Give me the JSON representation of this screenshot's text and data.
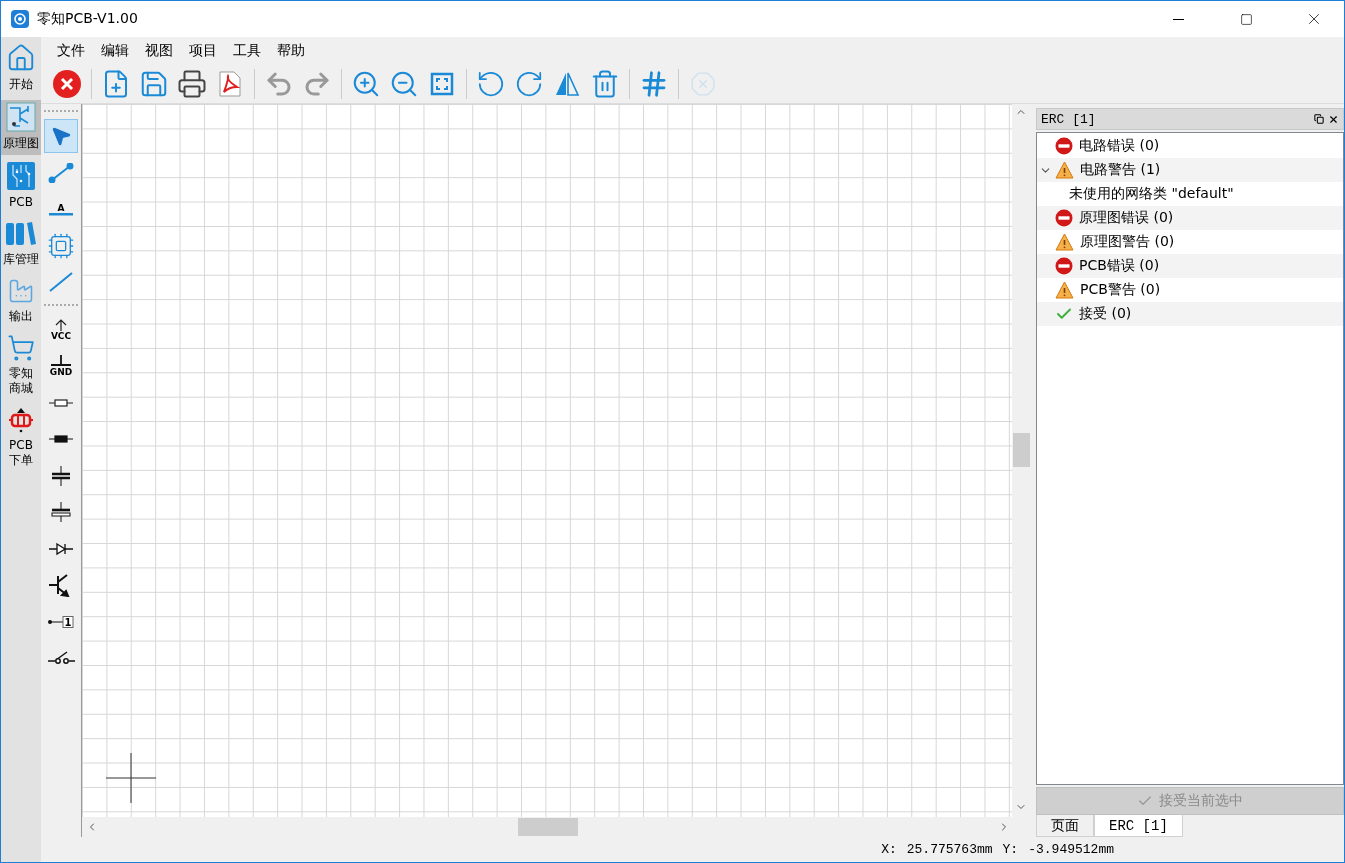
{
  "window": {
    "title": "零知PCB-V1.00"
  },
  "nav": [
    {
      "label": "开始",
      "selected": false
    },
    {
      "label": "原理图",
      "selected": true
    },
    {
      "label": "PCB",
      "selected": false
    },
    {
      "label": "库管理",
      "selected": false
    },
    {
      "label": "输出",
      "selected": false
    },
    {
      "label": "零知商城",
      "selected": false
    },
    {
      "label": "PCB下单",
      "selected": false
    }
  ],
  "menu": [
    "文件",
    "编辑",
    "视图",
    "项目",
    "工具",
    "帮助"
  ],
  "toolbar": [
    {
      "disabled": false
    },
    {
      "disabled": false
    },
    {
      "disabled": false
    },
    {
      "disabled": false
    },
    {
      "disabled": false
    },
    {
      "disabled": false
    },
    {
      "disabled": false
    },
    {
      "disabled": false
    },
    {
      "disabled": false
    },
    {
      "disabled": false
    },
    {
      "disabled": false
    },
    {
      "disabled": false
    },
    {
      "disabled": false
    },
    {
      "disabled": false
    },
    {
      "disabled": false
    },
    {
      "disabled": true
    }
  ],
  "tool_groups": [
    [
      {
        "selected": true
      },
      {
        "selected": false
      },
      {
        "selected": false,
        "label": "A"
      },
      {
        "selected": false
      },
      {
        "selected": false
      }
    ],
    [
      {
        "selected": false,
        "label": "VCC"
      },
      {
        "selected": false,
        "label": "GND"
      },
      {
        "selected": false
      },
      {
        "selected": false
      },
      {
        "selected": false
      },
      {
        "selected": false
      },
      {
        "selected": false
      },
      {
        "selected": false
      },
      {
        "selected": false,
        "label": "1"
      },
      {
        "selected": false
      }
    ]
  ],
  "erc_panel": {
    "title": "ERC [1]",
    "items": [
      {
        "kind": "error",
        "label": "电路错误 (0)"
      },
      {
        "kind": "warning",
        "label": "电路警告 (1)",
        "expanded": true,
        "children": [
          {
            "label": "未使用的网络类 \"default\""
          }
        ]
      },
      {
        "kind": "error",
        "label": "原理图错误 (0)"
      },
      {
        "kind": "warning",
        "label": "原理图警告 (0)"
      },
      {
        "kind": "error",
        "label": "PCB错误 (0)"
      },
      {
        "kind": "warning",
        "label": "PCB警告 (0)"
      },
      {
        "kind": "ok",
        "label": "接受 (0)"
      }
    ],
    "accept_button": {
      "label": "接受当前选中",
      "disabled": true
    },
    "tabs": [
      {
        "label": "页面",
        "selected": false
      },
      {
        "label": "ERC [1]",
        "selected": true
      }
    ]
  },
  "status_bar": {
    "x_label": "X:",
    "x_value": "25.775763mm",
    "y_label": "Y:",
    "y_value": "-3.949512mm"
  }
}
